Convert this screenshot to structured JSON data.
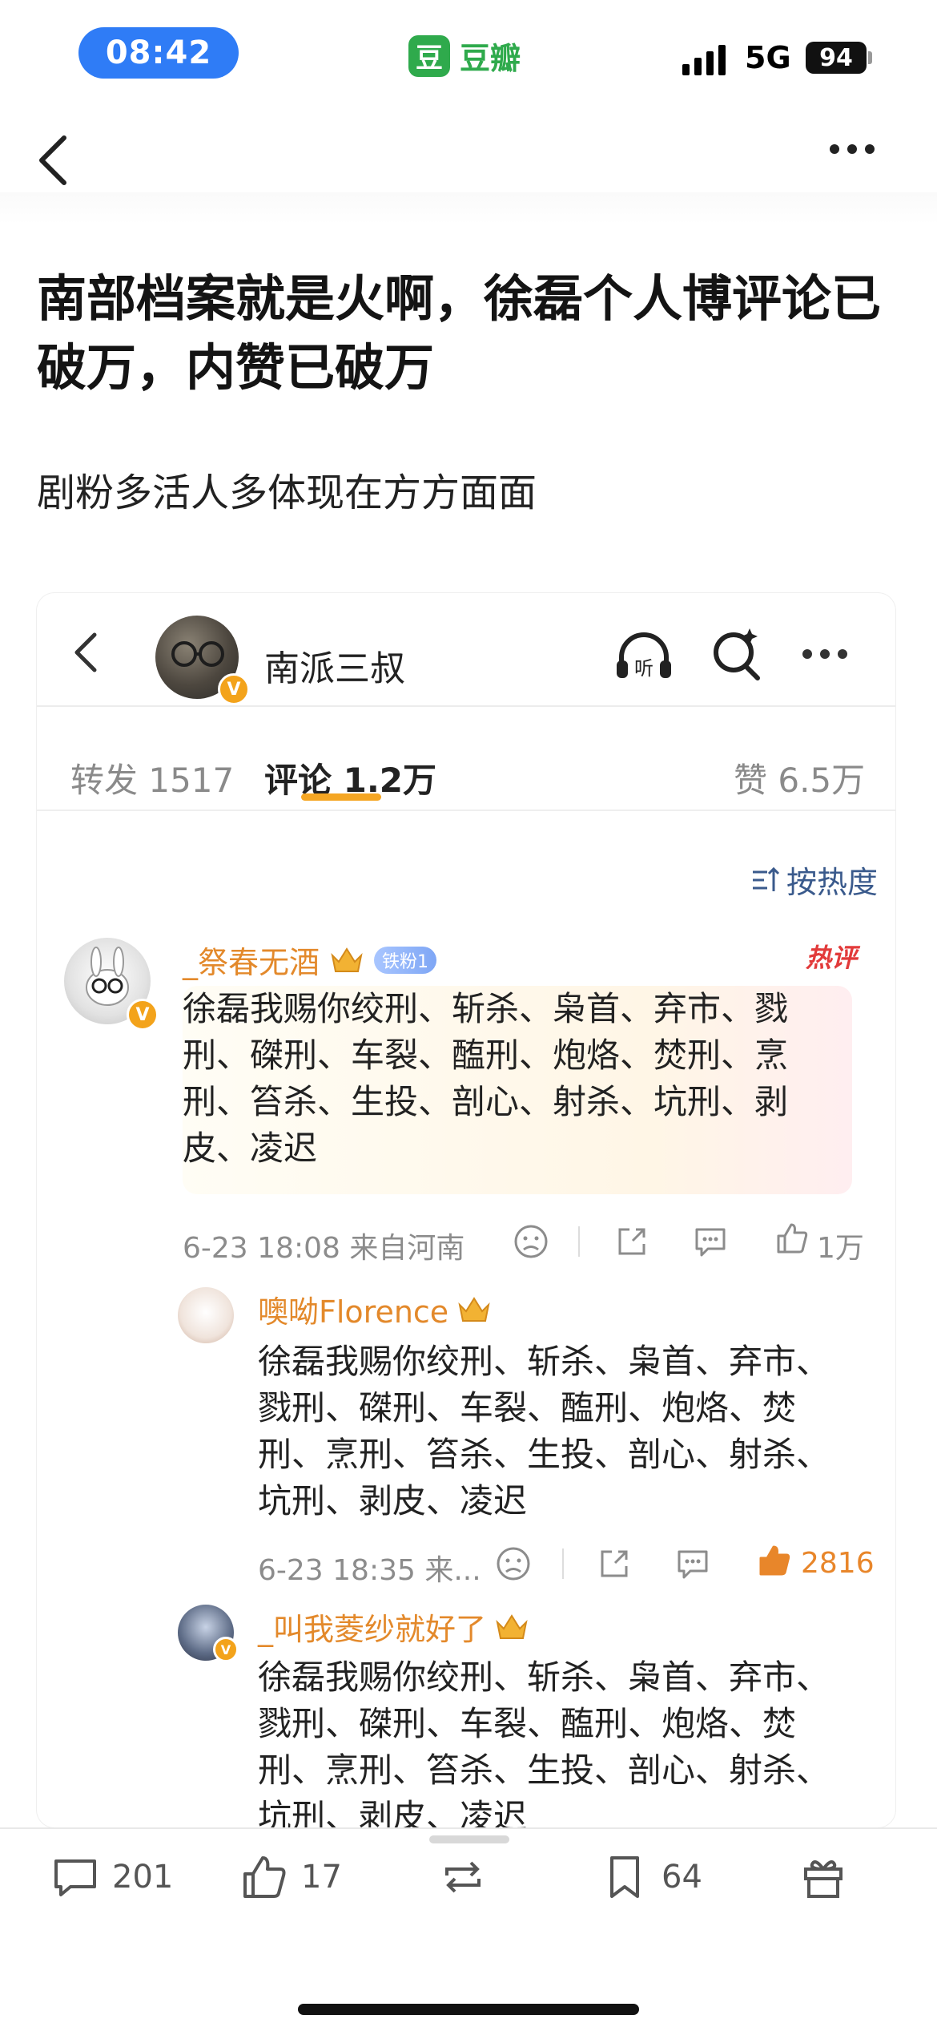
{
  "status_bar": {
    "time": "08:42",
    "app_logo_char": "豆",
    "app_name": "豆瓣",
    "network": "5G",
    "battery": "94"
  },
  "post": {
    "title": "南部档案就是火啊，徐磊个人博评论已破万，内赞已破万",
    "body": "剧粉多活人多体现在方方面面"
  },
  "embedded": {
    "account_name": "南派三叔",
    "verify_mark": "V",
    "listen_label": "听",
    "tabs": [
      {
        "label": "转发 1517"
      },
      {
        "label": "评论 1.2万"
      },
      {
        "label": "赞 6.5万"
      }
    ],
    "sort_label": "按热度",
    "comments": [
      {
        "name": "_祭春无酒",
        "fan_badge": "铁粉1",
        "hot_tag": "热评",
        "text_lines": [
          "徐磊我赐你绞刑、斩杀、枭首、弃市、戮",
          "刑、磔刑、车裂、醢刑、炮烙、焚刑、烹",
          "刑、笞杀、生投、剖心、射杀、坑刑、剥",
          "皮、凌迟"
        ],
        "meta": "6-23 18:08  来自河南",
        "likes": "1万"
      },
      {
        "name": "噢呦Florence",
        "text_lines": [
          "徐磊我赐你绞刑、斩杀、枭首、弃市、",
          "戮刑、磔刑、车裂、醢刑、炮烙、焚",
          "刑、烹刑、笞杀、生投、剖心、射杀、",
          "坑刑、剥皮、凌迟"
        ],
        "meta": "6-23 18:35  来...",
        "likes": "2816"
      },
      {
        "name": "_叫我菱纱就好了",
        "text_lines": [
          "徐磊我赐你绞刑、斩杀、枭首、弃市、",
          "戮刑、磔刑、车裂、醢刑、炮烙、焚",
          "刑、烹刑、笞杀、生投、剖心、射杀、",
          "坑刑、剥皮、凌迟"
        ]
      }
    ]
  },
  "bottom_bar": {
    "comments": "201",
    "likes": "17",
    "saves": "64"
  },
  "colors": {
    "accent_orange": "#f5a623",
    "name_orange": "#e3892b",
    "douban_green": "#2faa4c",
    "time_blue": "#2f7cf6",
    "like_orange": "#e8862a"
  }
}
